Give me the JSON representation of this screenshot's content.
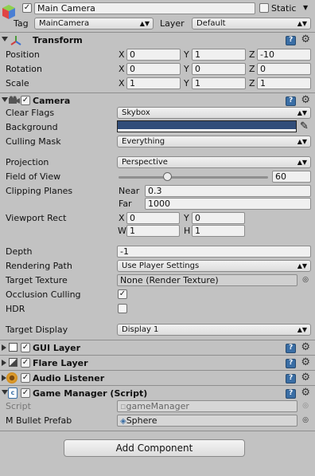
{
  "gameobject": {
    "active": true,
    "name": "Main Camera",
    "static_label": "Static",
    "static_checked": false,
    "tag_label": "Tag",
    "tag_value": "MainCamera",
    "layer_label": "Layer",
    "layer_value": "Default"
  },
  "transform": {
    "title": "Transform",
    "rows": [
      {
        "label": "Position",
        "x": "0",
        "y": "1",
        "z": "-10"
      },
      {
        "label": "Rotation",
        "x": "0",
        "y": "0",
        "z": "0"
      },
      {
        "label": "Scale",
        "x": "1",
        "y": "1",
        "z": "1"
      }
    ]
  },
  "axes": {
    "x": "X",
    "y": "Y",
    "z": "Z",
    "w": "W",
    "h": "H"
  },
  "camera": {
    "title": "Camera",
    "enabled": true,
    "clear_flags_label": "Clear Flags",
    "clear_flags_value": "Skybox",
    "background_label": "Background",
    "background_color": "#314d79",
    "culling_mask_label": "Culling Mask",
    "culling_mask_value": "Everything",
    "projection_label": "Projection",
    "projection_value": "Perspective",
    "fov_label": "Field of View",
    "fov_value": "60",
    "fov_fraction": 0.33,
    "clipping_label": "Clipping Planes",
    "near_label": "Near",
    "near_value": "0.3",
    "far_label": "Far",
    "far_value": "1000",
    "viewport_label": "Viewport Rect",
    "viewport_x": "0",
    "viewport_y": "0",
    "viewport_w": "1",
    "viewport_h": "1",
    "depth_label": "Depth",
    "depth_value": "-1",
    "rendering_path_label": "Rendering Path",
    "rendering_path_value": "Use Player Settings",
    "target_texture_label": "Target Texture",
    "target_texture_value": "None (Render Texture)",
    "occlusion_label": "Occlusion Culling",
    "occlusion_checked": true,
    "hdr_label": "HDR",
    "hdr_checked": false,
    "target_display_label": "Target Display",
    "target_display_value": "Display 1"
  },
  "components": [
    {
      "title": "GUI Layer",
      "enabled": true
    },
    {
      "title": "Flare Layer",
      "enabled": true
    },
    {
      "title": "Audio Listener",
      "enabled": true
    },
    {
      "title": "Game Manager (Script)",
      "enabled": true
    }
  ],
  "game_manager": {
    "script_label": "Script",
    "script_value": "gameManager",
    "bullet_label": "M Bullet Prefab",
    "bullet_value": "Sphere"
  },
  "add_component_label": "Add Component",
  "colors": {
    "background": "#c2c2c2",
    "swatch": "#314d79",
    "accent": "#3a6ea5"
  }
}
